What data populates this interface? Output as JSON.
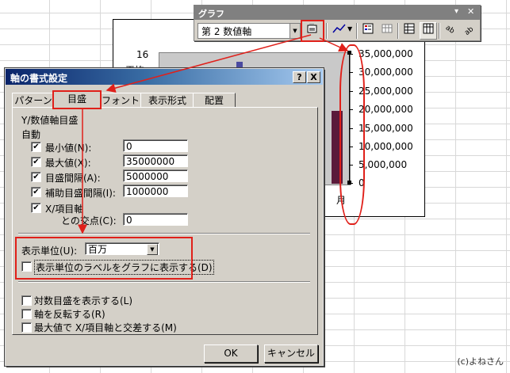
{
  "toolbar": {
    "title": "グラフ",
    "object_select": "第 2 数値軸",
    "title_buttons": [
      "▾",
      "✕"
    ]
  },
  "chart": {
    "left_label_16": "16",
    "left_label_partial": "平均",
    "right_axis_ticks": [
      "35,000,000",
      "30,000,000",
      "25,000,000",
      "20,000,000",
      "15,000,000",
      "10,000,000",
      "5,000,000",
      "0"
    ],
    "category_char": "月"
  },
  "dialog": {
    "title": "軸の書式設定",
    "title_buttons": [
      "?",
      "X"
    ],
    "tabs": [
      "パターン",
      "目盛",
      "フォント",
      "表示形式",
      "配置"
    ],
    "section_title": "Y/数値軸目盛",
    "auto_label": "自動",
    "rows": [
      {
        "label": "最小値(N):",
        "value": "0"
      },
      {
        "label": "最大値(X):",
        "value": "35000000"
      },
      {
        "label": "目盛間隔(A):",
        "value": "5000000"
      },
      {
        "label": "補助目盛間隔(I):",
        "value": "1000000"
      }
    ],
    "cross_label_1": "X/項目軸",
    "cross_label_2": "との交点(C):",
    "cross_value": "0",
    "display_unit_label": "表示単位(U):",
    "display_unit_value": "百万",
    "show_unit_label": "表示単位のラベルをグラフに表示する(D)",
    "log_scale": "対数目盛を表示する(L)",
    "reverse": "軸を反転する(R)",
    "cross_at_max": "最大値で X/項目軸と交差する(M)",
    "ok": "OK",
    "cancel": "キャンセル"
  },
  "credit": "(c)よねさん",
  "colors": {
    "annotation": "#e0201a"
  }
}
